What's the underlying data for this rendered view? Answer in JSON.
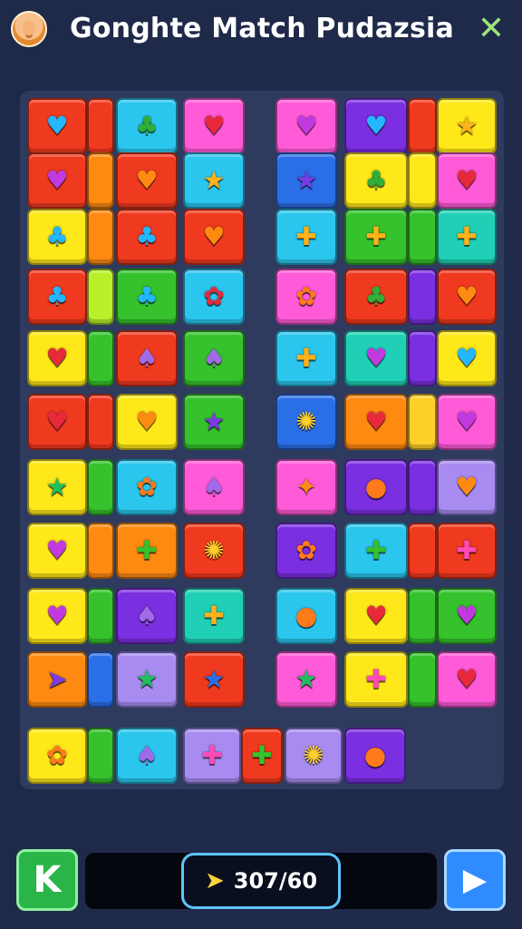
{
  "header": {
    "title": "Gonghte Match Pudazsia",
    "close_icon": "✕"
  },
  "score": {
    "value": "307/60",
    "icon": "bolt-icon"
  },
  "buttons": {
    "back": "K",
    "next": "▶"
  },
  "icons": {
    "heart": "♥",
    "star": "★",
    "tree": "♣",
    "cross": "✚",
    "flower": "✿",
    "blob": "●",
    "mushroom": "♠",
    "puzzle": "✦",
    "swirl": "✺",
    "bolt": "➤"
  }
}
